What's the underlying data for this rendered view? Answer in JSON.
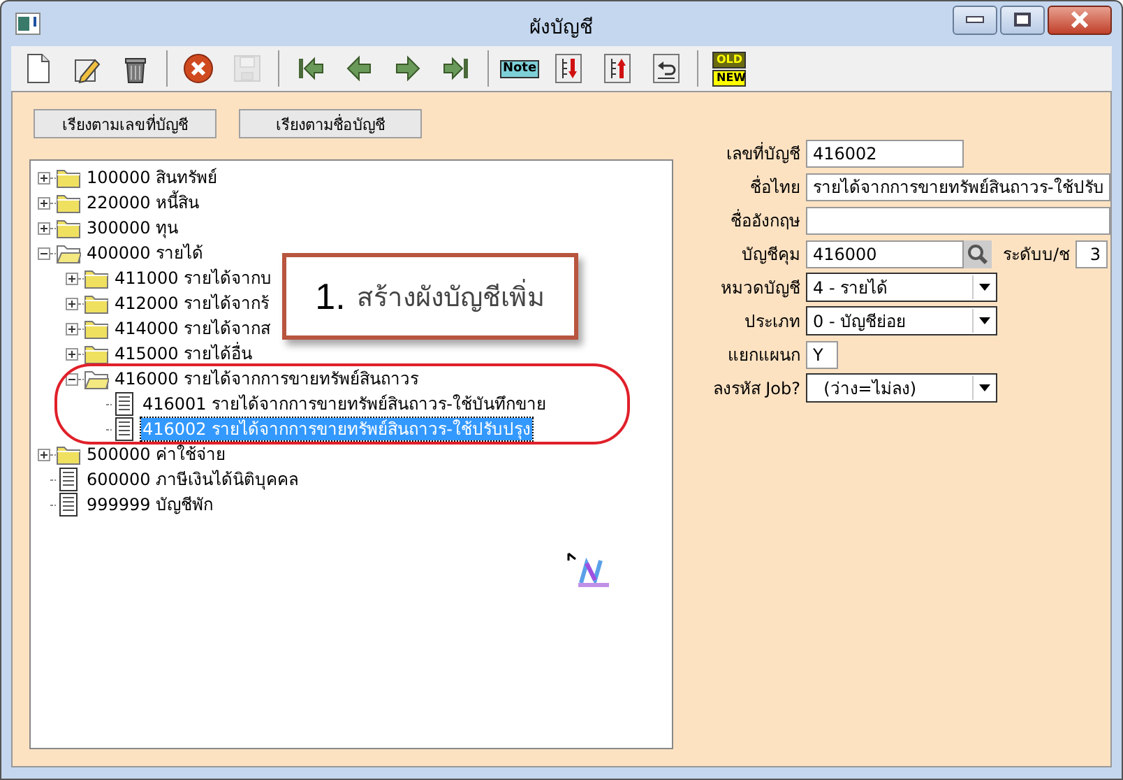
{
  "window": {
    "title": "ผังบัญชี"
  },
  "toolbar": [
    [
      {
        "kind": "new",
        "disabled": false
      },
      {
        "kind": "edit",
        "disabled": false
      },
      {
        "kind": "delete",
        "disabled": false
      }
    ],
    [
      {
        "kind": "cancel",
        "disabled": false
      },
      {
        "kind": "save",
        "disabled": true
      }
    ],
    [
      {
        "kind": "first",
        "disabled": false
      },
      {
        "kind": "prev",
        "disabled": false
      },
      {
        "kind": "next",
        "disabled": false
      },
      {
        "kind": "last",
        "disabled": false
      }
    ],
    [
      {
        "kind": "note",
        "disabled": false,
        "label": "Note"
      },
      {
        "kind": "sort-down",
        "disabled": false
      },
      {
        "kind": "sort-up",
        "disabled": false
      },
      {
        "kind": "undo",
        "disabled": false
      }
    ],
    [
      {
        "kind": "old-new",
        "disabled": false,
        "top": "OLD",
        "bottom": "NEW"
      }
    ]
  ],
  "sort_buttons": [
    "เรียงตามเลขที่บัญชี",
    "เรียงตามชื่อบัญชี"
  ],
  "tree": [
    {
      "label": "100000 สินทรัพย์",
      "kind": "folder",
      "expanded": false,
      "selected": false
    },
    {
      "label": "220000 หนี้สิน",
      "kind": "folder",
      "expanded": false,
      "selected": false
    },
    {
      "label": "300000 ทุน",
      "kind": "folder",
      "expanded": false,
      "selected": false
    },
    {
      "label": "400000 รายได้",
      "kind": "folder",
      "expanded": true,
      "selected": false,
      "children": [
        {
          "label": "411000 รายได้จากบ",
          "kind": "folder",
          "expanded": false,
          "selected": false
        },
        {
          "label": "412000 รายได้จากร้",
          "kind": "folder",
          "expanded": false,
          "selected": false
        },
        {
          "label": "414000 รายได้จากส",
          "kind": "folder",
          "expanded": false,
          "selected": false
        },
        {
          "label": "415000 รายได้อื่น",
          "kind": "folder",
          "expanded": false,
          "selected": false
        },
        {
          "label": "416000 รายได้จากการขายทรัพย์สินถาวร",
          "kind": "folder",
          "expanded": true,
          "selected": false,
          "children": [
            {
              "label": "416001 รายได้จากการขายทรัพย์สินถาวร-ใช้บันทึกขาย",
              "kind": "document",
              "selected": false
            },
            {
              "label": "416002 รายได้จากการขายทรัพย์สินถาวร-ใช้ปรับปรุง",
              "kind": "document",
              "selected": true
            }
          ]
        }
      ]
    },
    {
      "label": "500000 ค่าใช้จ่าย",
      "kind": "folder",
      "expanded": false,
      "selected": false
    },
    {
      "label": "600000 ภาษีเงินได้นิติบุคคล",
      "kind": "document",
      "selected": false
    },
    {
      "label": "999999 บัญชีพัก",
      "kind": "document",
      "selected": false
    }
  ],
  "callout": {
    "number": "1.",
    "text": "สร้างผังบัญชีเพิ่ม"
  },
  "form": [
    {
      "label": "เลขที่บัญชี",
      "kind": "short",
      "value": "416002"
    },
    {
      "label": "ชื่อไทย",
      "kind": "long",
      "value": "รายได้จากการขายทรัพย์สินถาวร-ใช้ปรับ"
    },
    {
      "label": "ชื่ออังกฤษ",
      "kind": "long"
    },
    {
      "label": "บัญชีคุม",
      "kind": "lookup",
      "value": "416000",
      "extra_label": "ระดับบ/ช",
      "extra_value": "3"
    },
    {
      "label": "หมวดบัญชี",
      "kind": "select",
      "value": "4 - รายได้"
    },
    {
      "label": "ประเภท",
      "kind": "select",
      "value": "0 - บัญชีย่อย"
    },
    {
      "label": "แยกแผนก",
      "kind": "flag",
      "value": "Y"
    },
    {
      "label": "ลงรหัส Job?",
      "kind": "select",
      "value": "  (ว่าง=ไม่ลง)"
    }
  ]
}
